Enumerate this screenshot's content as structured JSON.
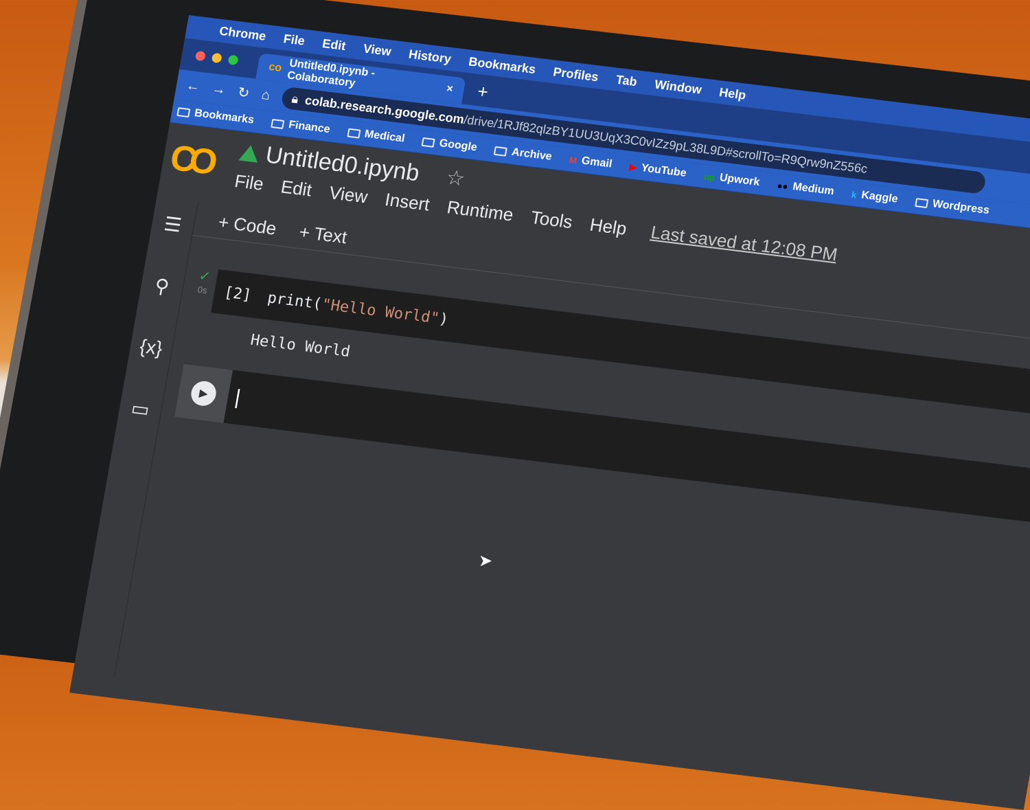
{
  "menubar": {
    "apple": "",
    "items": [
      "Chrome",
      "File",
      "Edit",
      "View",
      "History",
      "Bookmarks",
      "Profiles",
      "Tab",
      "Window",
      "Help"
    ]
  },
  "tab": {
    "title": "Untitled0.ipynb - Colaboratory",
    "close": "×",
    "new": "+"
  },
  "toolbar": {
    "back": "←",
    "forward": "→",
    "reload": "↻",
    "home": "⌂",
    "url_host": "colab.research.google.com",
    "url_path": "/drive/1RJf82qlzBY1UU3UqX3C0vIZz9pL38L9D#scrollTo=R9Qrw9nZ556c"
  },
  "bookmarks": [
    {
      "label": "Bookmarks",
      "icon": "folder"
    },
    {
      "label": "Finance",
      "icon": "folder"
    },
    {
      "label": "Medical",
      "icon": "folder"
    },
    {
      "label": "Google",
      "icon": "folder"
    },
    {
      "label": "Archive",
      "icon": "folder"
    },
    {
      "label": "Gmail",
      "icon": "gmail"
    },
    {
      "label": "YouTube",
      "icon": "youtube"
    },
    {
      "label": "Upwork",
      "icon": "upwork"
    },
    {
      "label": "Medium",
      "icon": "medium"
    },
    {
      "label": "Kaggle",
      "icon": "kaggle"
    },
    {
      "label": "Wordpress",
      "icon": "folder"
    }
  ],
  "colab": {
    "logo": "CO",
    "title": "Untitled0.ipynb",
    "menu": [
      "File",
      "Edit",
      "View",
      "Insert",
      "Runtime",
      "Tools",
      "Help"
    ],
    "last_saved": "Last saved at 12:08 PM",
    "add_code": "+ Code",
    "add_text": "+ Text"
  },
  "sidebar": {
    "icons": [
      "☰",
      "⚲",
      "{x}",
      "▭"
    ]
  },
  "cells": [
    {
      "exec": "[2]",
      "status": "✓",
      "time": "0s",
      "code_fn": "print(",
      "code_str": "\"Hello World\"",
      "code_end": ")",
      "output": "Hello World"
    }
  ],
  "colors": {
    "accent": "#2a62c7",
    "colab_orange": "#f9ab00",
    "success": "#34a853"
  }
}
